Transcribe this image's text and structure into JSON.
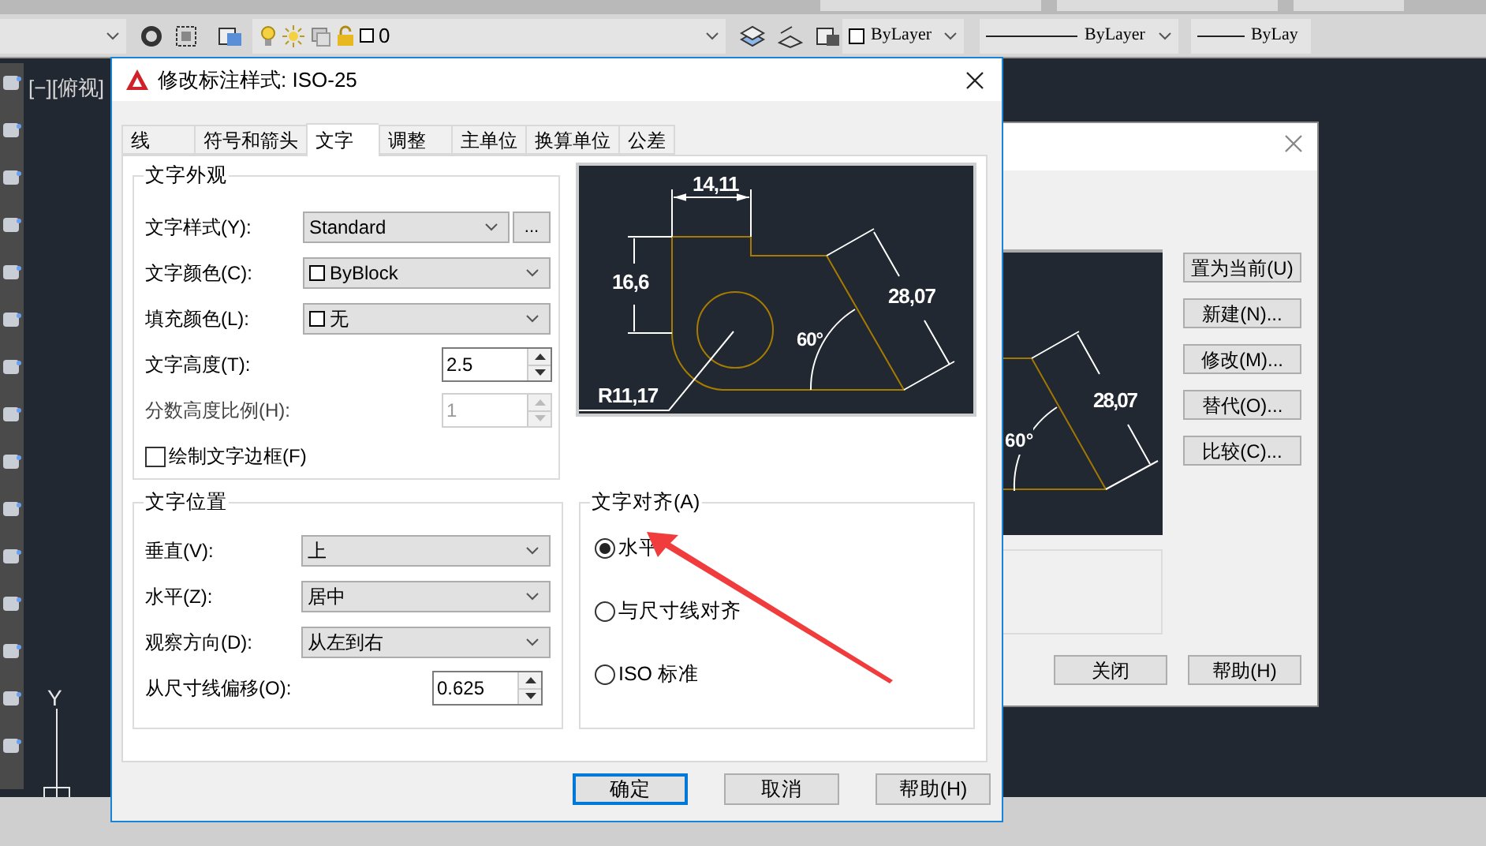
{
  "toolbar": {
    "layer_name": "0",
    "color_dropdown": "ByLayer",
    "linetype_dropdown": "ByLayer",
    "lineweight_dropdown": "ByLay"
  },
  "viewport": {
    "label": "[−][俯视]",
    "axis_label": "Y"
  },
  "background_dialog": {
    "preview_labels": [
      "28,07",
      "60°"
    ],
    "side_buttons": [
      "置为当前(U)",
      "新建(N)...",
      "修改(M)...",
      "替代(O)...",
      "比较(C)..."
    ],
    "bottom_buttons": [
      "关闭",
      "帮助(H)"
    ]
  },
  "dialog": {
    "title": "修改标注样式: ISO-25",
    "tabs": [
      {
        "label": "线",
        "selected": false
      },
      {
        "label": "符号和箭头",
        "selected": false
      },
      {
        "label": "文字",
        "selected": true
      },
      {
        "label": "调整",
        "selected": false
      },
      {
        "label": "主单位",
        "selected": false
      },
      {
        "label": "换算单位",
        "selected": false
      },
      {
        "label": "公差",
        "selected": false
      }
    ],
    "appearance": {
      "title": "文字外观",
      "rows": [
        {
          "kind": "select",
          "label": "文字样式(Y):",
          "value": "Standard",
          "extra_button": "..."
        },
        {
          "kind": "select",
          "label": "文字颜色(C):",
          "value": "ByBlock",
          "swatch": true
        },
        {
          "kind": "select",
          "label": "填充颜色(L):",
          "value": "无",
          "swatch": true
        },
        {
          "kind": "spinner",
          "label": "文字高度(T):",
          "value": "2.5"
        },
        {
          "kind": "spinner",
          "label": "分数高度比例(H):",
          "value": "1",
          "disabled": true
        },
        {
          "kind": "checkbox",
          "label": "绘制文字边框(F)",
          "checked": false
        }
      ]
    },
    "preview_labels": [
      "14,11",
      "16,6",
      "28,07",
      "60°",
      "R11,17"
    ],
    "placement": {
      "title": "文字位置",
      "rows": [
        {
          "kind": "select",
          "label": "垂直(V):",
          "value": "上"
        },
        {
          "kind": "select",
          "label": "水平(Z):",
          "value": "居中"
        },
        {
          "kind": "select",
          "label": "观察方向(D):",
          "value": "从左到右"
        },
        {
          "kind": "spinner",
          "label": "从尺寸线偏移(O):",
          "value": "0.625"
        }
      ]
    },
    "alignment": {
      "title": "文字对齐(A)",
      "options": [
        {
          "label": "水平",
          "selected": true
        },
        {
          "label": "与尺寸线对齐",
          "selected": false
        },
        {
          "label": "ISO 标准",
          "selected": false
        }
      ]
    },
    "buttons": [
      {
        "label": "确定",
        "focused": true
      },
      {
        "label": "取消",
        "focused": false
      },
      {
        "label": "帮助(H)",
        "focused": false
      }
    ]
  }
}
